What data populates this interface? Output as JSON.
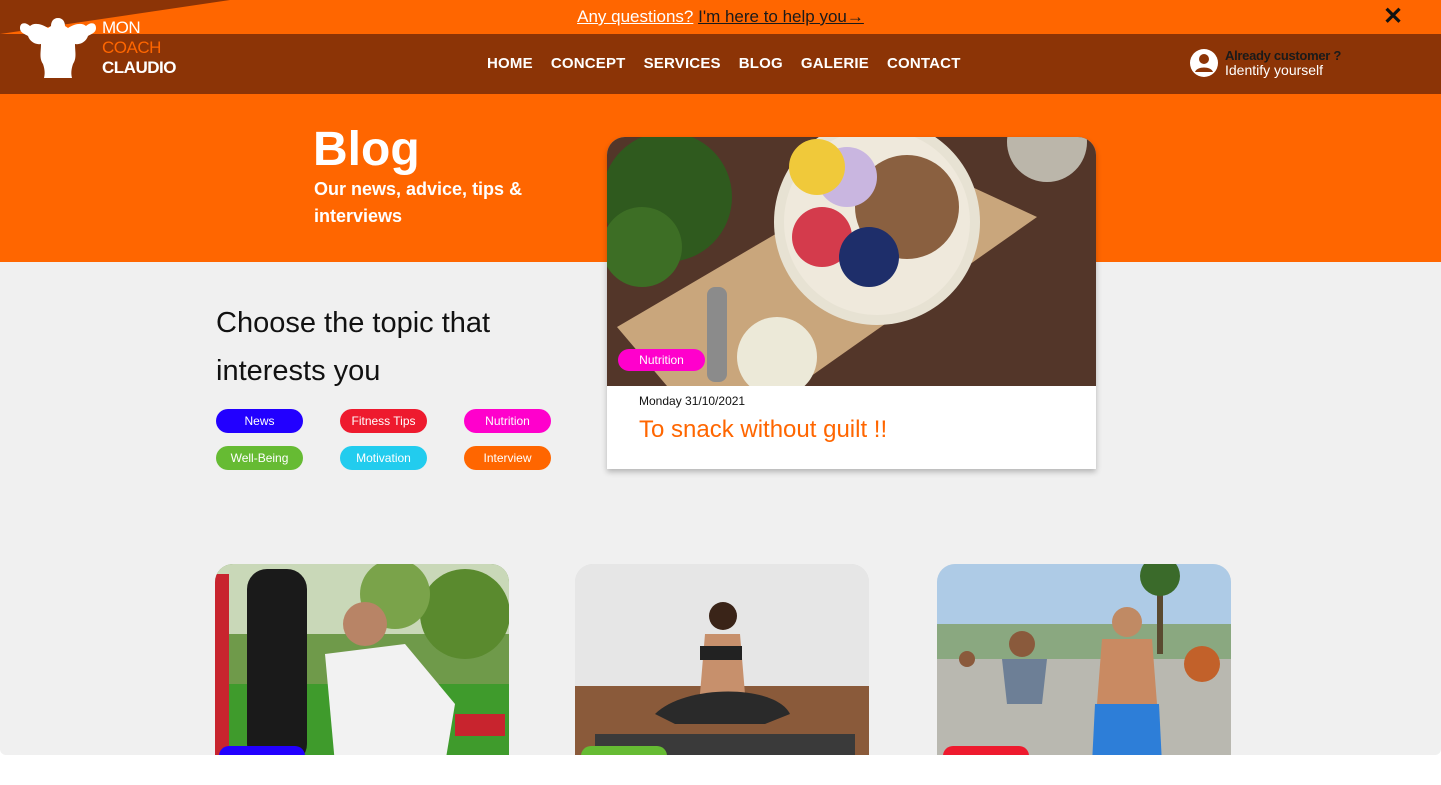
{
  "topbar": {
    "question_link": "Any questions?",
    "help_link": "I'm here to help you→",
    "close_icon": "close-icon"
  },
  "logo": {
    "line1": "MON",
    "line2": "COACH",
    "line3": "CLAUDIO",
    "icon": "bodybuilder-icon"
  },
  "nav": {
    "items": [
      {
        "label": "HOME"
      },
      {
        "label": "CONCEPT"
      },
      {
        "label": "SERVICES"
      },
      {
        "label": "BLOG"
      },
      {
        "label": "GALERIE"
      },
      {
        "label": "CONTACT"
      }
    ]
  },
  "account": {
    "line1": "Already customer ?",
    "line2": "Identify yourself",
    "icon": "user-circle-icon"
  },
  "hero": {
    "title": "Blog",
    "subtitle": "Our news, advice, tips & interviews"
  },
  "featured": {
    "badge": "Nutrition",
    "date": "Monday 31/10/2021",
    "title": "To snack without guilt !!",
    "badge_color": "#ff00cc"
  },
  "topics": {
    "heading": "Choose the topic that interests you",
    "items": [
      {
        "label": "News",
        "color": "#2200ff"
      },
      {
        "label": "Fitness Tips",
        "color": "#ee1a2e"
      },
      {
        "label": "Nutrition",
        "color": "#ff00cc"
      },
      {
        "label": "Well-Being",
        "color": "#66bb33"
      },
      {
        "label": "Motivation",
        "color": "#22ccee"
      },
      {
        "label": "Interview",
        "color": "#ff6600"
      }
    ]
  },
  "colors": {
    "brand_orange": "#ff6600",
    "brand_brown": "#8c3406",
    "background": "#f0f0f0"
  }
}
